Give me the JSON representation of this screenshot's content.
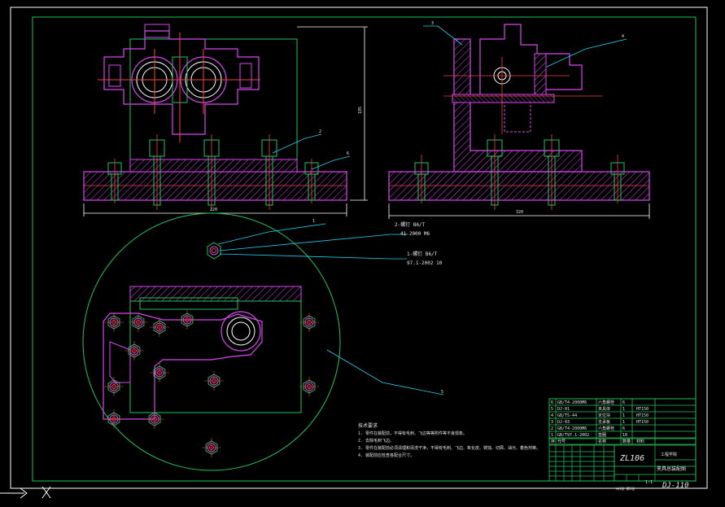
{
  "drawing": {
    "dimensions": {
      "front_width": "220",
      "front_height": "185",
      "side_width": "320"
    },
    "callouts": {
      "front_balloon_2": "2",
      "front_balloon_6": "6",
      "side_balloon_3": "3",
      "side_balloon_4": "4",
      "top_balloon_1": "1",
      "top_balloon_5": "5"
    },
    "annotations": [
      "2-螺钉 B6/T",
      "41-2000 M6",
      "1-螺钉 B6/T",
      "97.1-2002 10"
    ],
    "notes": {
      "title": "技术要求",
      "lines": [
        "1. 零件在装配前，不得有毛刺、飞边等等附件等不良现象。",
        "2. 去除毛刺飞边。",
        "3. 零件在装配前必须清理和清洗干净，不得有毛刺、飞边、氧化皮、锈蚀、切屑、油污、着色剂等。",
        "4. 装配前应检查各配合尺寸。"
      ]
    },
    "bom": [
      {
        "no": "6",
        "code": "GB/T4-2000M6",
        "name": "六角螺栓",
        "qty": "6",
        "material": ""
      },
      {
        "no": "5",
        "code": "DJ-01",
        "name": "夹具体",
        "qty": "1",
        "material": "HT150"
      },
      {
        "no": "4",
        "code": "GB/T5-44",
        "name": "定位块",
        "qty": "1",
        "material": "HT150"
      },
      {
        "no": "3",
        "code": "DJ-03",
        "name": "支承板",
        "qty": "1",
        "material": "HT150"
      },
      {
        "no": "2",
        "code": "GB/T4-2000M6",
        "name": "六角螺栓",
        "qty": "6",
        "material": ""
      },
      {
        "no": "1",
        "code": "GB/T97.1-2002",
        "name": "垫圈",
        "qty": "10",
        "material": ""
      }
    ],
    "bom_header": [
      "序",
      "代号",
      "名称",
      "数量",
      "材料"
    ],
    "title_block": {
      "part": "ZL106",
      "school": "工程学院",
      "drawing_name": "夹具总装配图",
      "drawing_no": "DJ-110",
      "scale": "1:1",
      "sheet": "共1张 第1张"
    }
  }
}
